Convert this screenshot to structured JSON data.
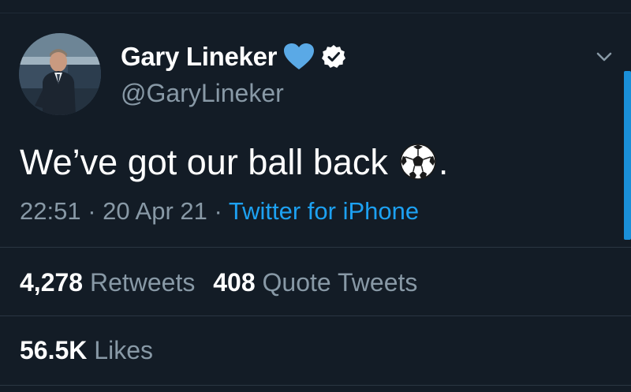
{
  "author": {
    "display_name": "Gary Lineker",
    "handle": "@GaryLineker",
    "name_emoji": "blue-heart-icon",
    "verified_icon": "verified-badge-icon"
  },
  "tweet": {
    "text": "We’ve got our ball back",
    "emoji": "soccer-ball-icon",
    "trailing": ".",
    "time": "22:51",
    "separator": "·",
    "date": "20 Apr 21",
    "source": "Twitter for iPhone"
  },
  "stats": {
    "retweets_count": "4,278",
    "retweets_label": "Retweets",
    "quotes_count": "408",
    "quotes_label": "Quote Tweets",
    "likes_count": "56.5K",
    "likes_label": "Likes"
  },
  "colors": {
    "background": "#131c26",
    "link": "#1da1f2",
    "secondary_text": "#8899a6",
    "heart": "#5aa9e6"
  }
}
